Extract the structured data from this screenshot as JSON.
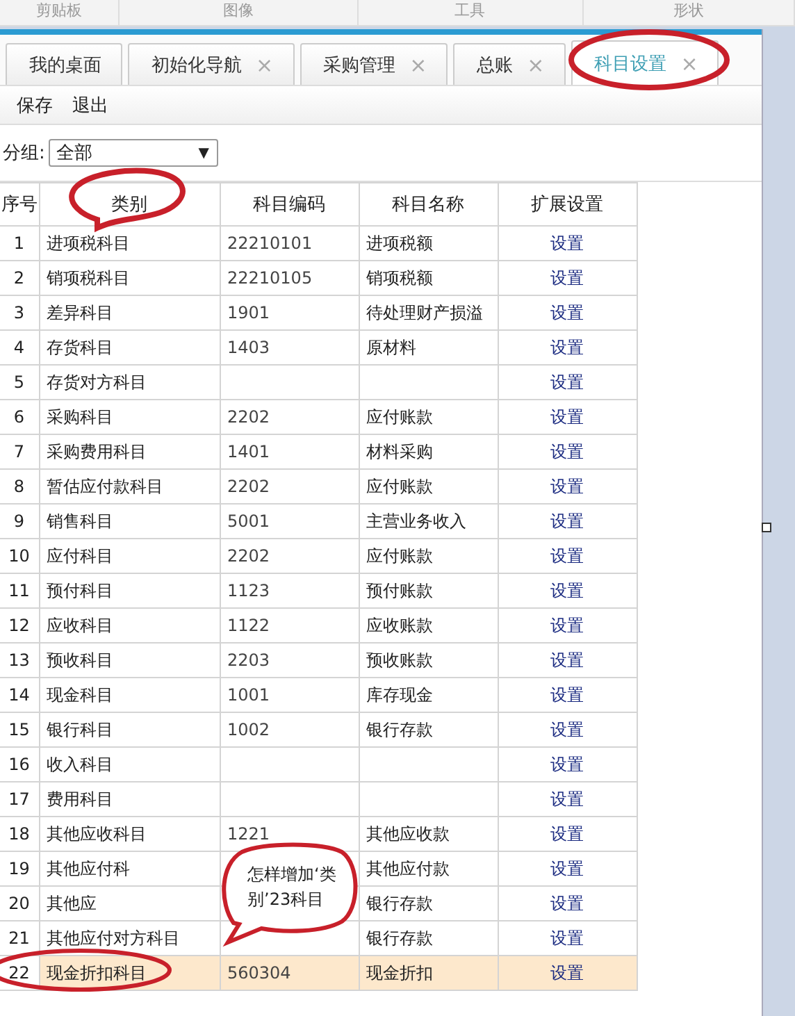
{
  "ribbon_groups": [
    "剪贴板",
    "图像",
    "工具",
    "形状"
  ],
  "tabs": [
    {
      "label": "我的桌面",
      "selected": false,
      "closable": false
    },
    {
      "label": "初始化导航",
      "selected": false,
      "closable": true
    },
    {
      "label": "采购管理",
      "selected": false,
      "closable": true
    },
    {
      "label": "总账",
      "selected": false,
      "closable": true
    },
    {
      "label": "科目设置",
      "selected": true,
      "closable": true
    }
  ],
  "tab_close": "×",
  "toolbar": [
    "保存",
    "退出"
  ],
  "filter": {
    "label": "分组:",
    "value": "全部",
    "arrow": "▼"
  },
  "table": {
    "columns": [
      "序号",
      "类别",
      "科目编码",
      "科目名称",
      "扩展设置"
    ],
    "rows": [
      {
        "no": "1",
        "category": "进项税科目",
        "code": "22210101",
        "name": "进项税额",
        "action": "设置",
        "selected": false
      },
      {
        "no": "2",
        "category": "销项税科目",
        "code": "22210105",
        "name": "销项税额",
        "action": "设置",
        "selected": false
      },
      {
        "no": "3",
        "category": "差异科目",
        "code": "1901",
        "name": "待处理财产损溢",
        "action": "设置",
        "selected": false
      },
      {
        "no": "4",
        "category": "存货科目",
        "code": "1403",
        "name": "原材料",
        "action": "设置",
        "selected": false
      },
      {
        "no": "5",
        "category": "存货对方科目",
        "action": "设置",
        "selected": false
      },
      {
        "no": "6",
        "category": "采购科目",
        "code": "2202",
        "name": "应付账款",
        "action": "设置",
        "selected": false
      },
      {
        "no": "7",
        "category": "采购费用科目",
        "code": "1401",
        "name": "材料采购",
        "action": "设置",
        "selected": false
      },
      {
        "no": "8",
        "category": "暂估应付款科目",
        "code": "2202",
        "name": "应付账款",
        "action": "设置",
        "selected": false
      },
      {
        "no": "9",
        "category": "销售科目",
        "code": "5001",
        "name": "主营业务收入",
        "action": "设置",
        "selected": false
      },
      {
        "no": "10",
        "category": "应付科目",
        "code": "2202",
        "name": "应付账款",
        "action": "设置",
        "selected": false
      },
      {
        "no": "11",
        "category": "预付科目",
        "code": "1123",
        "name": "预付账款",
        "action": "设置",
        "selected": false
      },
      {
        "no": "12",
        "category": "应收科目",
        "code": "1122",
        "name": "应收账款",
        "action": "设置",
        "selected": false
      },
      {
        "no": "13",
        "category": "预收科目",
        "code": "2203",
        "name": "预收账款",
        "action": "设置",
        "selected": false
      },
      {
        "no": "14",
        "category": "现金科目",
        "code": "1001",
        "name": "库存现金",
        "action": "设置",
        "selected": false
      },
      {
        "no": "15",
        "category": "银行科目",
        "code": "1002",
        "name": "银行存款",
        "action": "设置",
        "selected": false
      },
      {
        "no": "16",
        "category": "收入科目",
        "action": "设置",
        "selected": false
      },
      {
        "no": "17",
        "category": "费用科目",
        "action": "设置",
        "selected": false
      },
      {
        "no": "18",
        "category": "其他应收科目",
        "code": "1221",
        "name": "其他应收款",
        "action": "设置",
        "selected": false
      },
      {
        "no": "19",
        "category": "其他应付科",
        "name": "其他应付款",
        "action": "设置",
        "selected": false
      },
      {
        "no": "20",
        "category": "其他应",
        "name": "银行存款",
        "action": "设置",
        "selected": false
      },
      {
        "no": "21",
        "category": "其他应付对方科目",
        "name": "银行存款",
        "action": "设置",
        "selected": false
      },
      {
        "no": "22",
        "category": "现金折扣科目",
        "code": "560304",
        "name": "现金折扣",
        "action": "设置",
        "selected": true
      }
    ]
  },
  "note": {
    "text": "怎样增加‘类别’23科目"
  }
}
